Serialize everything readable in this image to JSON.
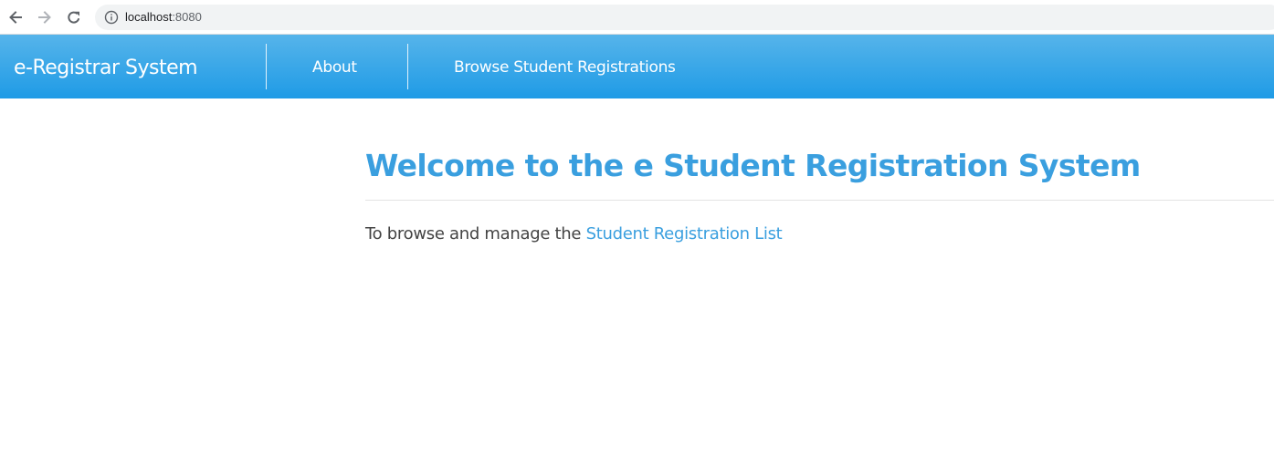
{
  "browser": {
    "url_host": "localhost",
    "url_port": ":8080",
    "icons": {
      "back": "arrow-left-icon",
      "forward": "arrow-right-icon",
      "reload": "reload-icon",
      "info": "info-icon"
    }
  },
  "navbar": {
    "brand": "e-Registrar System",
    "links": [
      {
        "label": "About"
      },
      {
        "label": "Browse Student Registrations"
      }
    ],
    "colors": {
      "gradient_top": "#56b4ea",
      "gradient_bottom": "#1f9be6",
      "text": "#ffffff"
    }
  },
  "main": {
    "title": "Welcome to the e Student Registration System",
    "intro_text": "To browse and manage the ",
    "intro_link": "Student Registration List",
    "colors": {
      "accent": "#3a9fdf",
      "body_text": "#444444"
    }
  }
}
